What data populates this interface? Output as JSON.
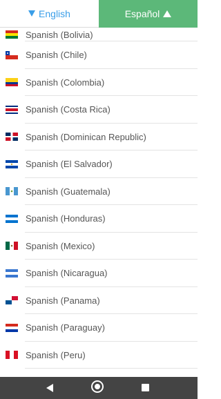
{
  "tabs": {
    "english": "English",
    "espanol": "Español"
  },
  "items": [
    {
      "label": "Spanish (Bolivia)",
      "flag": "bolivia-flag"
    },
    {
      "label": "Spanish (Chile)",
      "flag": "chile-flag"
    },
    {
      "label": "Spanish (Colombia)",
      "flag": "colombia-flag"
    },
    {
      "label": "Spanish (Costa Rica)",
      "flag": "costa-rica-flag"
    },
    {
      "label": "Spanish (Dominican Republic)",
      "flag": "dominican-republic-flag"
    },
    {
      "label": "Spanish (El Salvador)",
      "flag": "el-salvador-flag"
    },
    {
      "label": "Spanish (Guatemala)",
      "flag": "guatemala-flag"
    },
    {
      "label": "Spanish (Honduras)",
      "flag": "honduras-flag"
    },
    {
      "label": "Spanish (Mexico)",
      "flag": "mexico-flag"
    },
    {
      "label": "Spanish (Nicaragua)",
      "flag": "nicaragua-flag"
    },
    {
      "label": "Spanish (Panama)",
      "flag": "panama-flag"
    },
    {
      "label": "Spanish (Paraguay)",
      "flag": "paraguay-flag"
    },
    {
      "label": "Spanish (Peru)",
      "flag": "peru-flag"
    }
  ],
  "colors": {
    "tab_active": "#5cb879",
    "tab_text": "#3a9ee8",
    "navbar": "#444444"
  },
  "icons": {
    "back": "back-triangle-icon",
    "home": "home-circle-icon",
    "recents": "recents-square-icon"
  }
}
